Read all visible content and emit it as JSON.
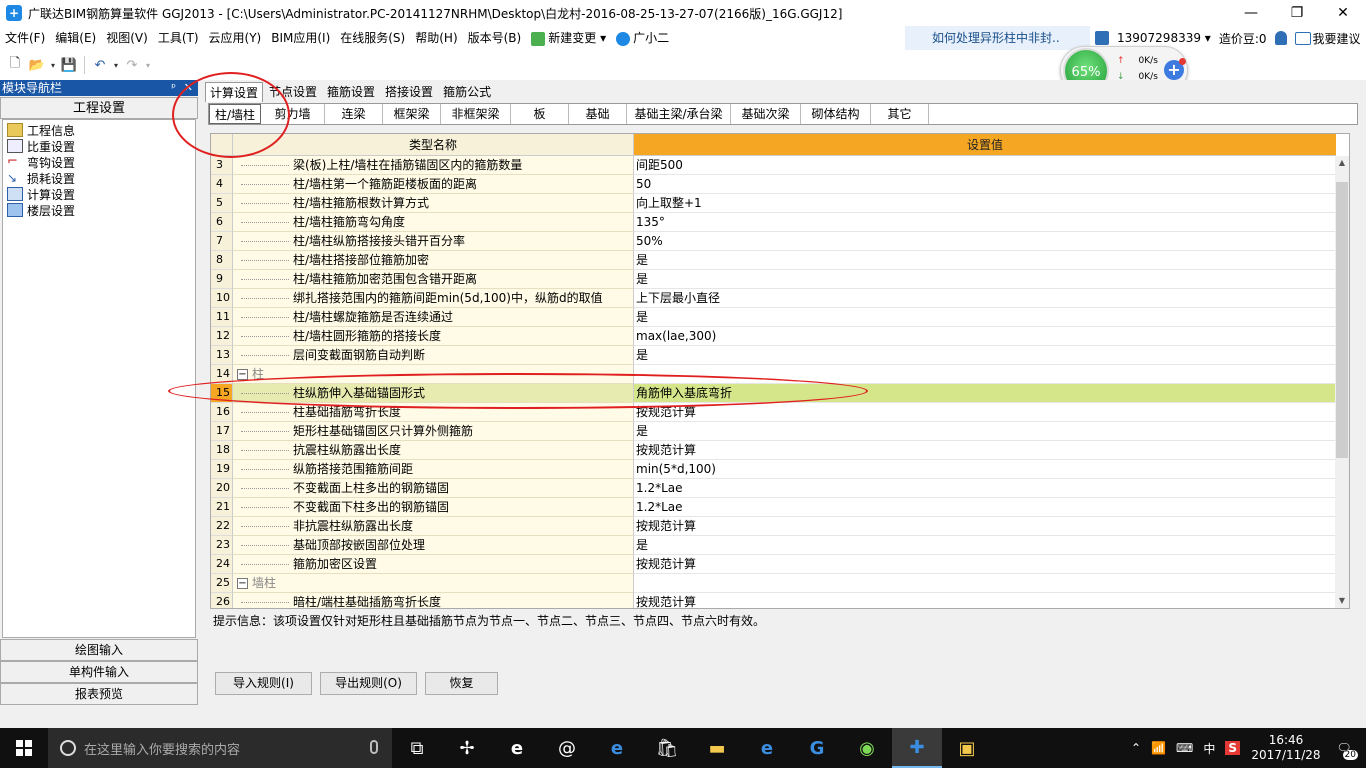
{
  "window": {
    "title": "广联达BIM钢筋算量软件 GGJ2013 - [C:\\Users\\Administrator.PC-20141127NRHM\\Desktop\\白龙村-2016-08-25-13-27-07(2166版)_16G.GGJ12]",
    "controls": [
      "—",
      "❐",
      "✕"
    ]
  },
  "menu": {
    "items": [
      "文件(F)",
      "编辑(E)",
      "视图(V)",
      "工具(T)",
      "云应用(Y)",
      "BIM应用(I)",
      "在线服务(S)",
      "帮助(H)",
      "版本号(B)",
      "新建变更",
      "广小二"
    ],
    "faq": "如何处理异形柱中非封..",
    "phone": "13907298339",
    "beans": "造价豆:0",
    "suggest": "我要建议"
  },
  "speed": {
    "percent": "65%",
    "up": "0K/s",
    "down": "0K/s"
  },
  "nav": {
    "header": "模块导航栏",
    "pin": "ᵖ",
    "close": "✕",
    "section": "工程设置",
    "items": [
      "工程信息",
      "比重设置",
      "弯钩设置",
      "损耗设置",
      "计算设置",
      "楼层设置"
    ],
    "selected": 4,
    "bottom": [
      "绘图输入",
      "单构件输入",
      "报表预览"
    ]
  },
  "tabs": {
    "top": [
      "计算设置",
      "节点设置",
      "箍筋设置",
      "搭接设置",
      "箍筋公式"
    ],
    "sub": [
      "柱/墙柱",
      "剪力墙",
      "连梁",
      "框架梁",
      "非框架梁",
      "板",
      "基础",
      "基础主梁/承台梁",
      "基础次梁",
      "砌体结构",
      "其它"
    ]
  },
  "grid": {
    "col_name": "类型名称",
    "col_value": "设置值",
    "rows": [
      {
        "no": "3",
        "name": "梁(板)上柱/墙柱在插筋锚固区内的箍筋数量",
        "value": "间距500"
      },
      {
        "no": "4",
        "name": "柱/墙柱第一个箍筋距楼板面的距离",
        "value": "50"
      },
      {
        "no": "5",
        "name": "柱/墙柱箍筋根数计算方式",
        "value": "向上取整+1"
      },
      {
        "no": "6",
        "name": "柱/墙柱箍筋弯勾角度",
        "value": "135°"
      },
      {
        "no": "7",
        "name": "柱/墙柱纵筋搭接接头错开百分率",
        "value": "50%"
      },
      {
        "no": "8",
        "name": "柱/墙柱搭接部位箍筋加密",
        "value": "是"
      },
      {
        "no": "9",
        "name": "柱/墙柱箍筋加密范围包含错开距离",
        "value": "是"
      },
      {
        "no": "10",
        "name": "绑扎搭接范围内的箍筋间距min(5d,100)中，纵筋d的取值",
        "value": "上下层最小直径"
      },
      {
        "no": "11",
        "name": "柱/墙柱螺旋箍筋是否连续通过",
        "value": "是"
      },
      {
        "no": "12",
        "name": "柱/墙柱圆形箍筋的搭接长度",
        "value": "max(lae,300)"
      },
      {
        "no": "13",
        "name": "层间变截面钢筋自动判断",
        "value": "是"
      },
      {
        "no": "14",
        "name": "柱",
        "value": "",
        "group": true
      },
      {
        "no": "15",
        "name": "柱纵筋伸入基础锚固形式",
        "value": "角筋伸入基底弯折",
        "highlight": true
      },
      {
        "no": "16",
        "name": "柱基础插筋弯折长度",
        "value": "按规范计算"
      },
      {
        "no": "17",
        "name": "矩形柱基础锚固区只计算外侧箍筋",
        "value": "是"
      },
      {
        "no": "18",
        "name": "抗震柱纵筋露出长度",
        "value": "按规范计算"
      },
      {
        "no": "19",
        "name": "纵筋搭接范围箍筋间距",
        "value": "min(5*d,100)"
      },
      {
        "no": "20",
        "name": "不变截面上柱多出的钢筋锚固",
        "value": "1.2*Lae"
      },
      {
        "no": "21",
        "name": "不变截面下柱多出的钢筋锚固",
        "value": "1.2*Lae"
      },
      {
        "no": "22",
        "name": "非抗震柱纵筋露出长度",
        "value": "按规范计算"
      },
      {
        "no": "23",
        "name": "基础顶部按嵌固部位处理",
        "value": "是"
      },
      {
        "no": "24",
        "name": "箍筋加密区设置",
        "value": "按规范计算"
      },
      {
        "no": "25",
        "name": "墙柱",
        "value": "",
        "group": true
      },
      {
        "no": "26",
        "name": "暗柱/端柱基础插筋弯折长度",
        "value": "按规范计算"
      }
    ]
  },
  "hint": "提示信息：该项设置仅针对矩形柱且基础插筋节点为节点一、节点二、节点三、节点四、节点六时有效。",
  "buttons": {
    "import": "导入规则(I)",
    "export": "导出规则(O)",
    "restore": "恢复"
  },
  "taskbar": {
    "search_placeholder": "在这里输入你要搜索的内容",
    "time": "16:46",
    "date": "2017/11/28",
    "ime": "中",
    "notifications": "20"
  }
}
